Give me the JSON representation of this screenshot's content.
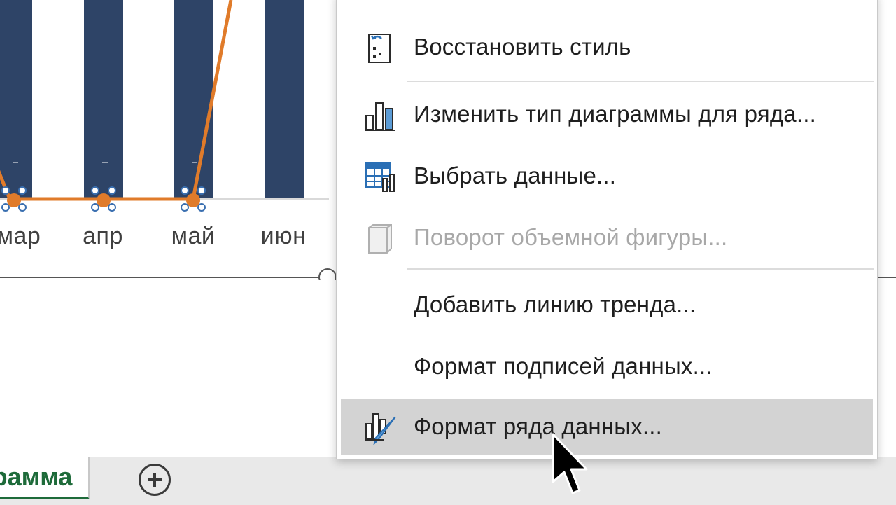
{
  "chart": {
    "categories_visible": [
      "мар",
      "апр",
      "май",
      "июн"
    ]
  },
  "sheet": {
    "active_tab_label": "рамма",
    "add_sheet_icon": "plus-circle-icon"
  },
  "context_menu": {
    "items": [
      {
        "label": "Восстановить стиль",
        "icon": "reset-style-icon",
        "disabled": false
      },
      {
        "label": "Изменить тип диаграммы для ряда...",
        "icon": "change-chart-type-icon",
        "disabled": false
      },
      {
        "label": "Выбрать данные...",
        "icon": "select-data-icon",
        "disabled": false
      },
      {
        "label": "Поворот объемной фигуры...",
        "icon": "3d-rotation-icon",
        "disabled": true
      },
      {
        "label": "Добавить линию тренда...",
        "icon": "",
        "disabled": false
      },
      {
        "label": "Формат подписей данных...",
        "icon": "",
        "disabled": false
      },
      {
        "label": "Формат ряда данных...",
        "icon": "format-series-icon",
        "disabled": false,
        "highlighted": true
      }
    ]
  },
  "colors": {
    "bar": "#2e4467",
    "line": "#e07b2a",
    "accent_green": "#1e6b3a",
    "menu_highlight": "#d3d3d3"
  }
}
